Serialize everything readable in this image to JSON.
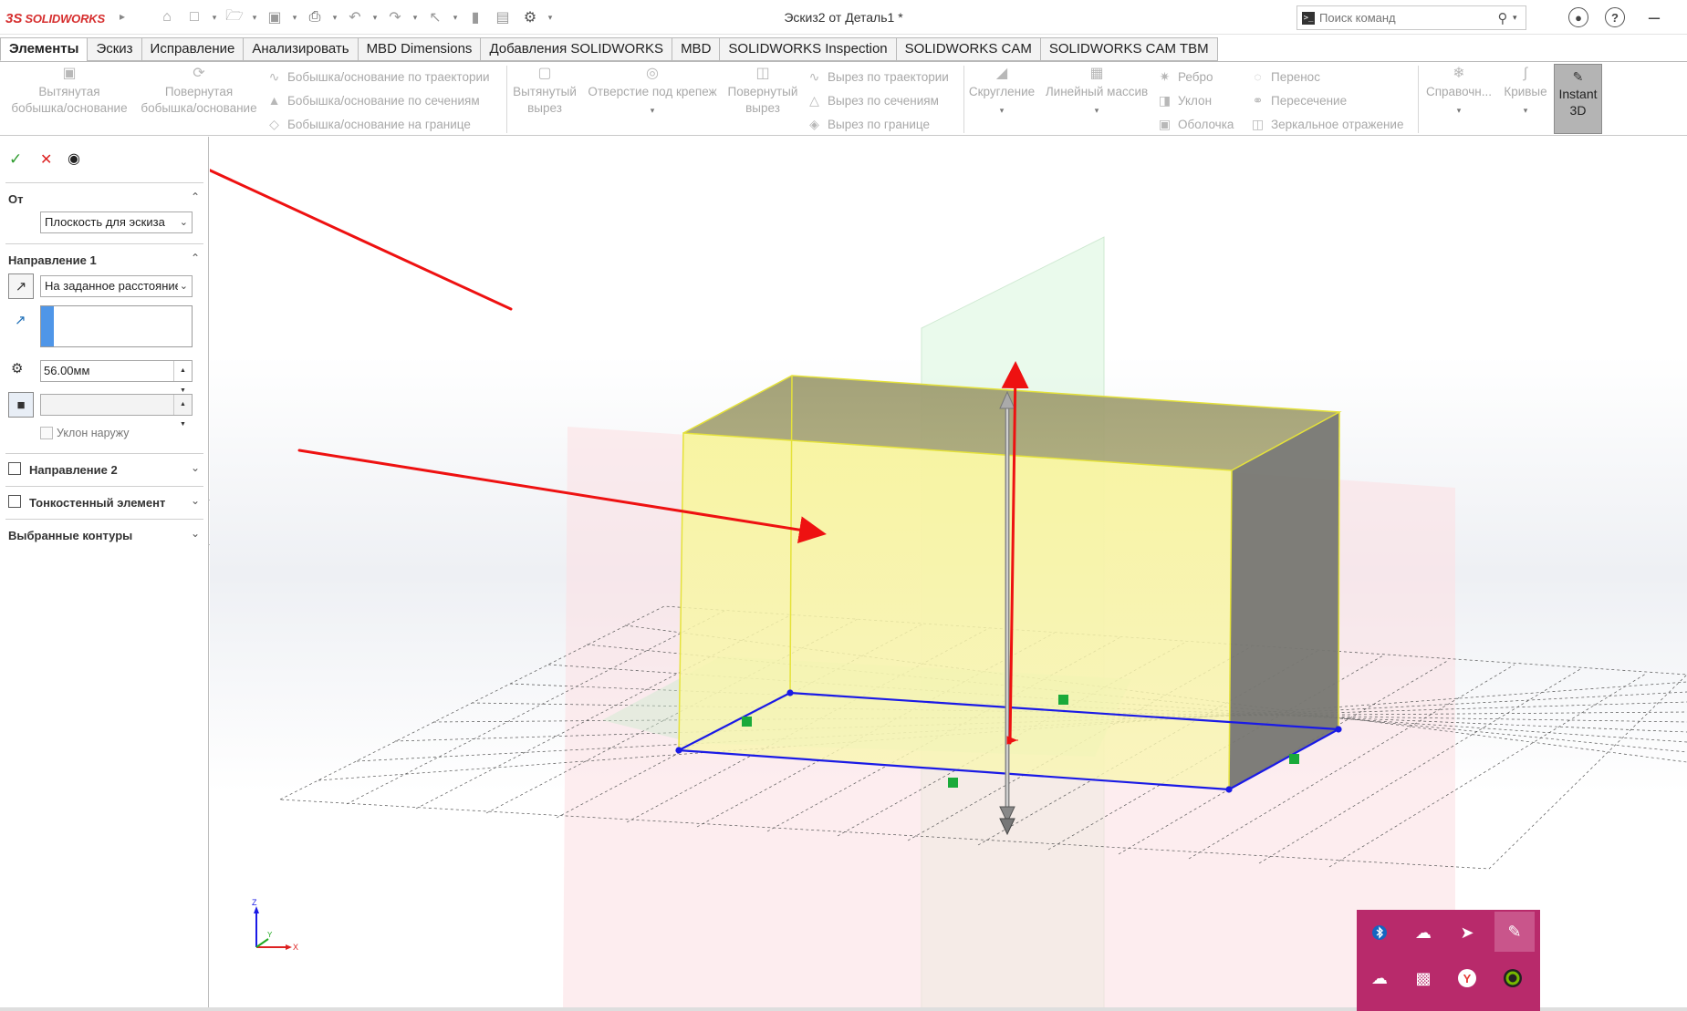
{
  "app": {
    "logo_glyph": "3S",
    "logo_text": "SOLIDWORKS",
    "doc_title": "Эскиз2 от Деталь1 *",
    "search_placeholder": "Поиск команд",
    "accent_color": "#d62e2e"
  },
  "quick_access": [
    {
      "icon": "home-icon"
    },
    {
      "icon": "new-document-icon"
    },
    {
      "icon": "open-folder-icon"
    },
    {
      "icon": "save-icon"
    },
    {
      "icon": "print-icon"
    },
    {
      "icon": "undo-icon"
    },
    {
      "icon": "redo-icon"
    },
    {
      "icon": "select-pointer-icon"
    },
    {
      "icon": "rebuild-icon"
    },
    {
      "icon": "file-properties-icon"
    },
    {
      "icon": "options-gear-icon"
    }
  ],
  "tabs": [
    {
      "label": "Элементы",
      "active": true
    },
    {
      "label": "Эскиз"
    },
    {
      "label": "Исправление"
    },
    {
      "label": "Анализировать"
    },
    {
      "label": "MBD Dimensions"
    },
    {
      "label": "Добавления SOLIDWORKS"
    },
    {
      "label": "MBD"
    },
    {
      "label": "SOLIDWORKS Inspection"
    },
    {
      "label": "SOLIDWORKS CAM"
    },
    {
      "label": "SOLIDWORKS CAM TBM"
    }
  ],
  "commands": {
    "extruded_boss": {
      "line1": "Вытянутая",
      "line2": "бобышка/основание"
    },
    "revolved_boss": {
      "line1": "Повернутая",
      "line2": "бобышка/основание"
    },
    "boss_sweep": "Бобышка/основание по траектории",
    "boss_loft": "Бобышка/основание по сечениям",
    "boss_boundary": "Бобышка/основание на границе",
    "extruded_cut": {
      "line1": "Вытянутый",
      "line2": "вырез"
    },
    "hole_wizard": {
      "line1": "Отверстие под крепеж"
    },
    "revolved_cut": {
      "line1": "Повернутый",
      "line2": "вырез"
    },
    "cut_sweep": "Вырез по траектории",
    "cut_loft": "Вырез по сечениям",
    "cut_boundary": "Вырез по границе",
    "fillet": "Скругление",
    "linear_pattern": "Линейный массив",
    "rib": "Ребро",
    "draft": "Уклон",
    "shell": "Оболочка",
    "wrap": "Перенос",
    "intersect": "Пересечение",
    "mirror": "Зеркальное отражение",
    "reference": "Справочн...",
    "curves": "Кривые",
    "instant3d": {
      "line1": "Instant",
      "line2": "3D"
    }
  },
  "property_manager": {
    "from_section": "От",
    "from_value": "Плоскость для эскиза",
    "direction1_section": "Направление 1",
    "end_condition": "На заданное расстояние",
    "depth_value": "56.00мм",
    "draft_outward": "Уклон наружу",
    "direction2_section": "Направление 2",
    "thin_feature_section": "Тонкостенный элемент",
    "selected_contours_section": "Выбранные контуры"
  },
  "triad": {
    "x": "X",
    "y": "Y",
    "z": "Z"
  },
  "tray_icons": [
    {
      "icon": "bluetooth-icon"
    },
    {
      "icon": "cloud-app-icon"
    },
    {
      "icon": "telegram-icon"
    },
    {
      "icon": "pen-app-icon",
      "selected": true
    },
    {
      "icon": "cloud-sync-off-icon"
    },
    {
      "icon": "display-icon"
    },
    {
      "icon": "yandex-browser-icon"
    },
    {
      "icon": "nvidia-icon"
    }
  ],
  "colors": {
    "sketch_blue": "#1a1ae6",
    "annotation_red": "#ee1111",
    "tray_bg": "#b82a6b",
    "selection_blue": "#4f96e8"
  }
}
